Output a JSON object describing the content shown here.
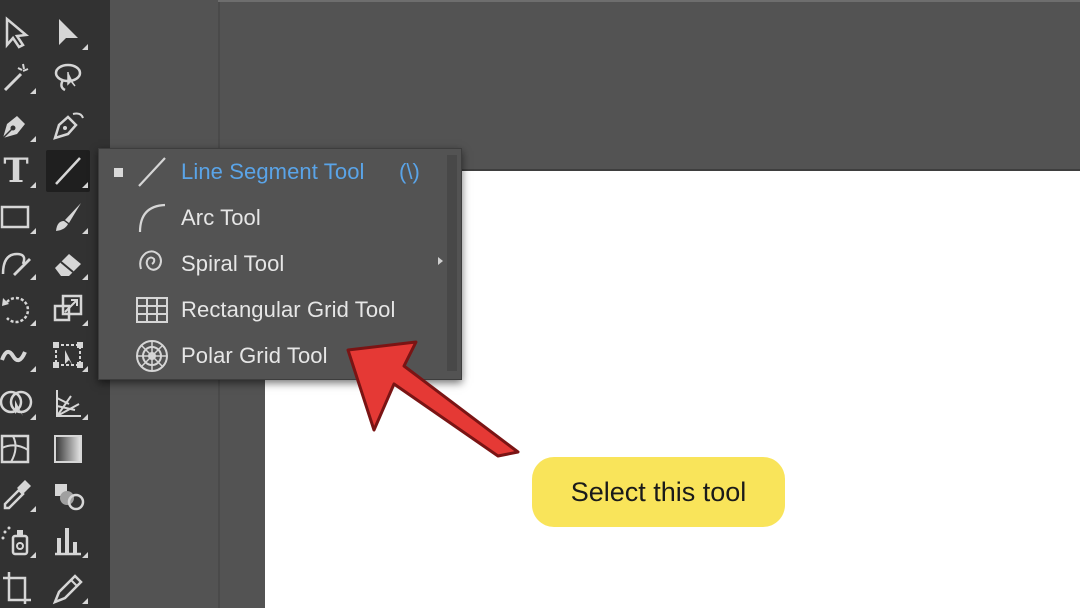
{
  "toolbar": {
    "tools": [
      {
        "name": "selection-tool",
        "icon": "selection-arrow-icon"
      },
      {
        "name": "direct-selection-tool",
        "icon": "direct-selection-arrow-icon"
      },
      {
        "name": "magic-wand-tool",
        "icon": "magic-wand-icon"
      },
      {
        "name": "lasso-tool",
        "icon": "lasso-icon"
      },
      {
        "name": "pen-tool",
        "icon": "pen-icon"
      },
      {
        "name": "curvature-tool",
        "icon": "curvature-pen-icon"
      },
      {
        "name": "type-tool",
        "icon": "type-icon",
        "glyph": "T"
      },
      {
        "name": "line-segment-tool",
        "icon": "line-segment-icon"
      },
      {
        "name": "rectangle-tool",
        "icon": "rectangle-icon"
      },
      {
        "name": "paintbrush-tool",
        "icon": "paintbrush-icon"
      },
      {
        "name": "shaper-tool",
        "icon": "shaper-icon"
      },
      {
        "name": "eraser-tool",
        "icon": "eraser-icon"
      },
      {
        "name": "rotate-tool",
        "icon": "rotate-icon"
      },
      {
        "name": "scale-tool",
        "icon": "scale-icon"
      },
      {
        "name": "warp-tool",
        "icon": "warp-icon"
      },
      {
        "name": "free-transform-tool",
        "icon": "free-transform-icon"
      },
      {
        "name": "shape-builder-tool",
        "icon": "shape-builder-icon"
      },
      {
        "name": "perspective-grid-tool",
        "icon": "perspective-grid-icon"
      },
      {
        "name": "mesh-tool",
        "icon": "mesh-icon"
      },
      {
        "name": "gradient-tool",
        "icon": "gradient-icon"
      },
      {
        "name": "eyedropper-tool",
        "icon": "eyedropper-icon"
      },
      {
        "name": "blend-tool",
        "icon": "blend-icon"
      },
      {
        "name": "symbol-sprayer-tool",
        "icon": "symbol-sprayer-icon"
      },
      {
        "name": "column-graph-tool",
        "icon": "column-graph-icon"
      },
      {
        "name": "artboard-tool",
        "icon": "artboard-icon"
      },
      {
        "name": "slice-tool",
        "icon": "slice-icon"
      }
    ]
  },
  "flyout": {
    "items": [
      {
        "label": "Line Segment Tool",
        "shortcut": "(\\)",
        "icon": "line-segment-icon",
        "selected": true
      },
      {
        "label": "Arc Tool",
        "icon": "arc-icon"
      },
      {
        "label": "Spiral Tool",
        "icon": "spiral-icon"
      },
      {
        "label": "Rectangular Grid Tool",
        "icon": "rectangular-grid-icon"
      },
      {
        "label": "Polar Grid Tool",
        "icon": "polar-grid-icon"
      }
    ]
  },
  "callout": {
    "text": "Select this tool",
    "color": "#f9e45a"
  },
  "colors": {
    "toolbar_bg": "#323232",
    "pasteboard": "#535353",
    "artboard": "#ffffff",
    "selected_text": "#5aa4e8",
    "arrow": "#e53935"
  }
}
